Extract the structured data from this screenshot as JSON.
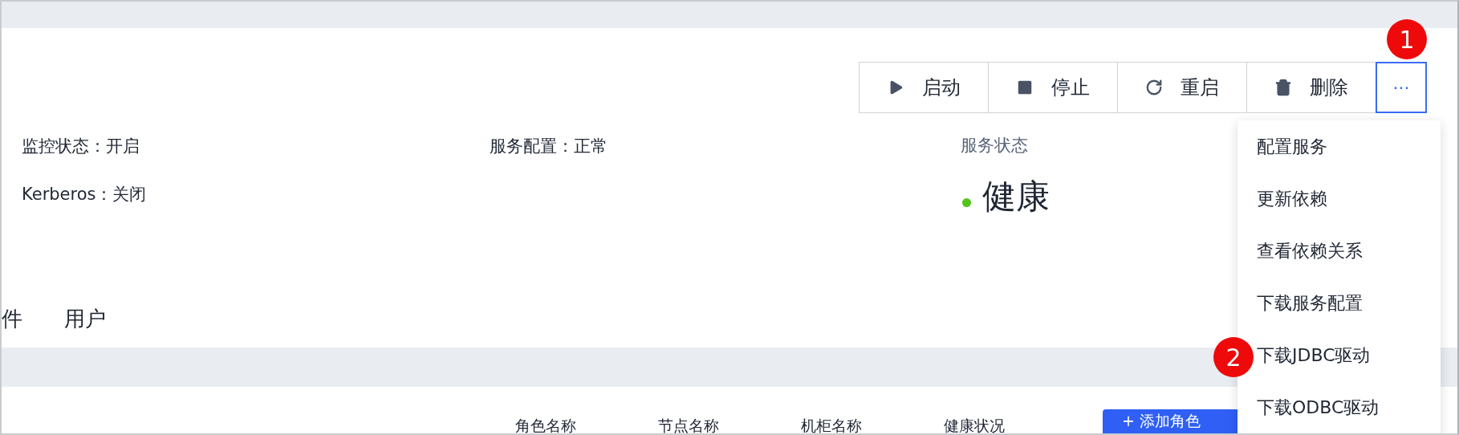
{
  "toolbar": {
    "buttons": [
      {
        "kind": "play",
        "label": "启动"
      },
      {
        "kind": "stop",
        "label": "停止"
      },
      {
        "kind": "restart",
        "label": "重启"
      },
      {
        "kind": "delete",
        "label": "删除"
      }
    ],
    "more": {
      "label": "···",
      "expanded": true
    }
  },
  "info": [
    {
      "label": "监控状态：开启"
    },
    {
      "label": "服务配置：正常"
    },
    {
      "label": "Kerberos：关闭"
    }
  ],
  "service_status": {
    "title": "服务状态",
    "value": "健康",
    "color": "#52c41a"
  },
  "tabs": [
    {
      "label": "件",
      "selected": false
    },
    {
      "label": "用户",
      "selected": false
    }
  ],
  "menu": [
    {
      "label": "配置服务"
    },
    {
      "label": "更新依赖"
    },
    {
      "label": "查看依赖关系"
    },
    {
      "label": "下载服务配置"
    },
    {
      "label": "下载JDBC驱动"
    },
    {
      "label": "下载ODBC驱动"
    }
  ],
  "table_header": {
    "columns": [
      "角色名称",
      "节点名称",
      "机柜名称",
      "健康状况"
    ],
    "button": "+ 添加角色"
  },
  "callouts": [
    {
      "label": "1"
    },
    {
      "label": "2"
    }
  ]
}
